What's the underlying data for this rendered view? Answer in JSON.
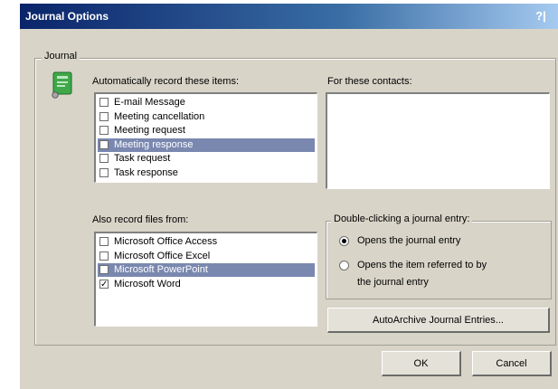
{
  "window": {
    "title": "Journal Options",
    "help": "?|"
  },
  "journal_group": {
    "legend": "Journal"
  },
  "items_section": {
    "label": "Automatically record these items:",
    "items": [
      {
        "label": "E-mail Message",
        "checked": false,
        "selected": false
      },
      {
        "label": "Meeting cancellation",
        "checked": false,
        "selected": false
      },
      {
        "label": "Meeting request",
        "checked": false,
        "selected": false
      },
      {
        "label": "Meeting response",
        "checked": false,
        "selected": true
      },
      {
        "label": "Task request",
        "checked": false,
        "selected": false
      },
      {
        "label": "Task response",
        "checked": false,
        "selected": false
      }
    ]
  },
  "contacts_section": {
    "label": "For these contacts:",
    "items": []
  },
  "files_section": {
    "label": "Also record files from:",
    "items": [
      {
        "label": "Microsoft Office Access",
        "checked": false,
        "selected": false
      },
      {
        "label": "Microsoft Office Excel",
        "checked": false,
        "selected": false
      },
      {
        "label": "Microsoft PowerPoint",
        "checked": false,
        "selected": true
      },
      {
        "label": "Microsoft Word",
        "checked": true,
        "selected": false
      }
    ]
  },
  "double_click_section": {
    "legend": "Double-clicking a journal entry:",
    "option1": "Opens the journal entry",
    "option2_line1": "Opens the item referred to by",
    "option2_line2": "the journal entry",
    "selected_option": 1
  },
  "buttons": {
    "autoarchive": "AutoArchive Journal Entries...",
    "ok": "OK",
    "cancel": "Cancel"
  },
  "check_glyph": "✓"
}
